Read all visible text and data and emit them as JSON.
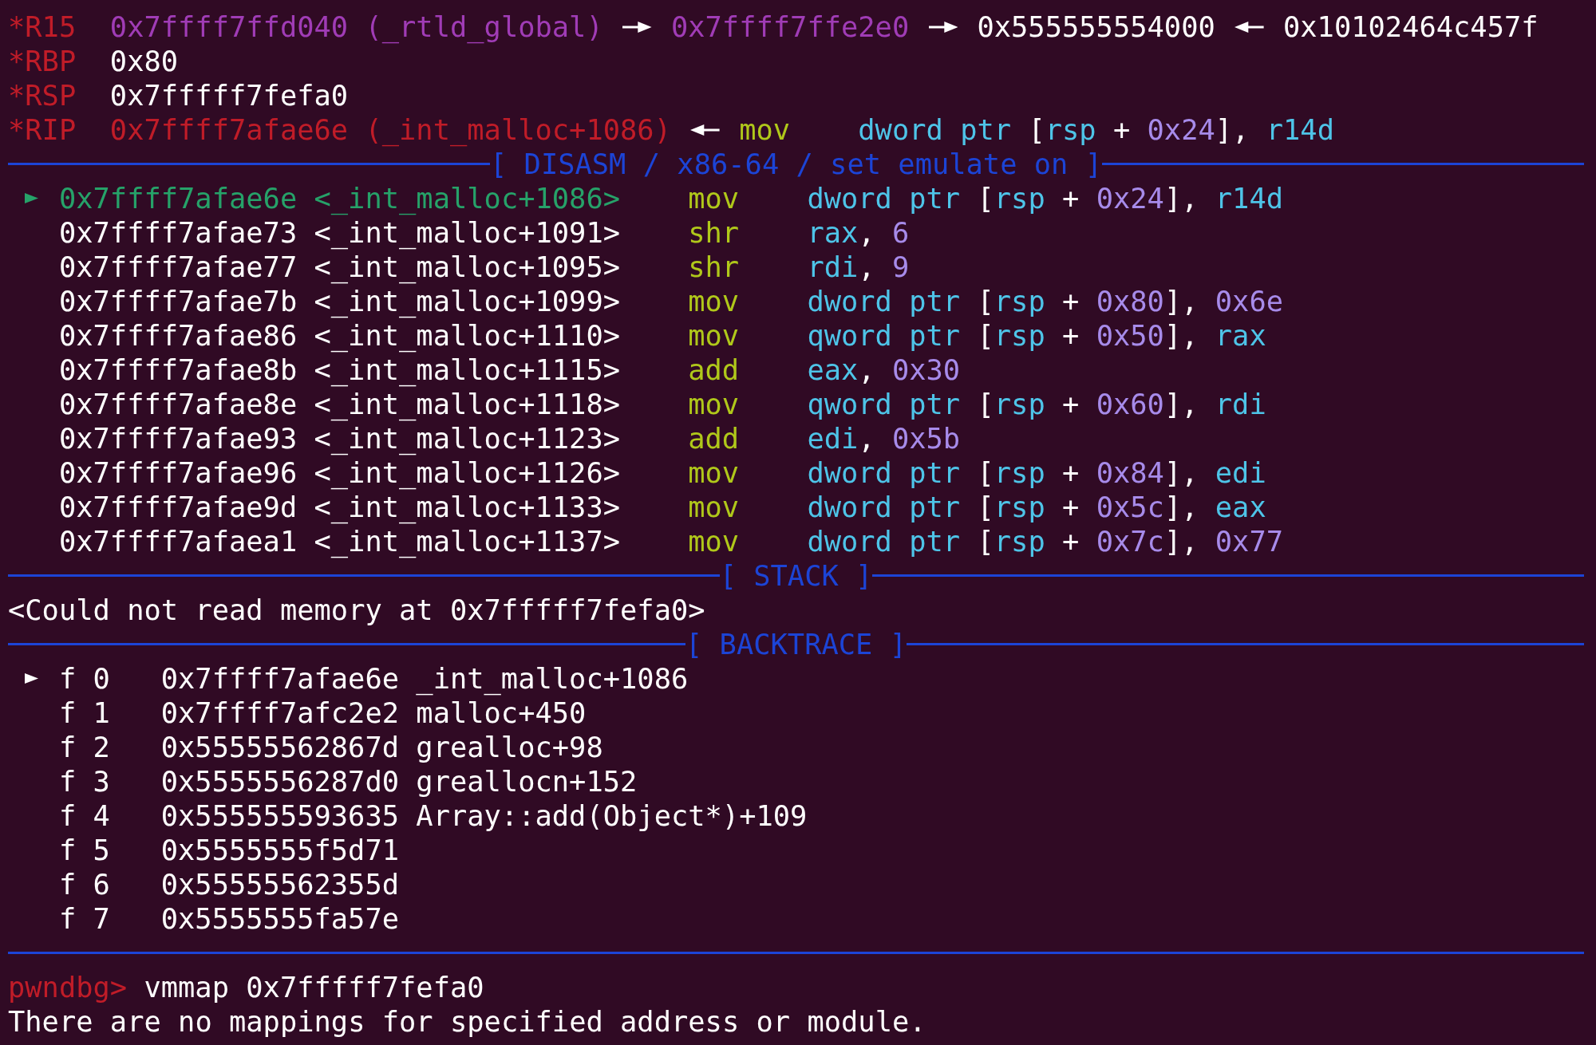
{
  "registers": [
    {
      "name": "*R15",
      "chain": [
        {
          "kind": "value",
          "text": "0x7ffff7ffd040 (_rtld_global)",
          "color": "#a03cb6"
        },
        {
          "kind": "arrow-right"
        },
        {
          "kind": "value",
          "text": "0x7ffff7ffe2e0",
          "color": "#a03cb6"
        },
        {
          "kind": "arrow-right"
        },
        {
          "kind": "value",
          "text": "0x555555554000",
          "color": "#ffffff"
        },
        {
          "kind": "arrow-left"
        },
        {
          "kind": "value",
          "text": "0x10102464c457f",
          "color": "#ffffff"
        }
      ]
    },
    {
      "name": "*RBP",
      "chain": [
        {
          "kind": "value",
          "text": "0x80",
          "color": "#ffffff"
        }
      ]
    },
    {
      "name": "*RSP",
      "chain": [
        {
          "kind": "value",
          "text": "0x7fffff7fefa0",
          "color": "#ffffff"
        }
      ]
    },
    {
      "name": "*RIP",
      "chain": [
        {
          "kind": "value",
          "text": "0x7ffff7afae6e (_int_malloc+1086)",
          "color": "#c01c28"
        },
        {
          "kind": "arrow-left"
        },
        {
          "kind": "instruction",
          "mnemonic": "mov",
          "operands": "dword ptr [rsp + 0x24], r14d"
        }
      ]
    }
  ],
  "disasm": {
    "title": "[ DISASM / x86-64 / set emulate on ]",
    "rows": [
      {
        "address": "0x7ffff7afae6e",
        "symbol": "<_int_malloc+1086>",
        "mnemonic": "mov",
        "operands": "dword ptr [rsp + 0x24], r14d",
        "current": true
      },
      {
        "address": "0x7ffff7afae73",
        "symbol": "<_int_malloc+1091>",
        "mnemonic": "shr",
        "operands": "rax, 6",
        "current": false
      },
      {
        "address": "0x7ffff7afae77",
        "symbol": "<_int_malloc+1095>",
        "mnemonic": "shr",
        "operands": "rdi, 9",
        "current": false
      },
      {
        "address": "0x7ffff7afae7b",
        "symbol": "<_int_malloc+1099>",
        "mnemonic": "mov",
        "operands": "dword ptr [rsp + 0x80], 0x6e",
        "current": false
      },
      {
        "address": "0x7ffff7afae86",
        "symbol": "<_int_malloc+1110>",
        "mnemonic": "mov",
        "operands": "qword ptr [rsp + 0x50], rax",
        "current": false
      },
      {
        "address": "0x7ffff7afae8b",
        "symbol": "<_int_malloc+1115>",
        "mnemonic": "add",
        "operands": "eax, 0x30",
        "current": false
      },
      {
        "address": "0x7ffff7afae8e",
        "symbol": "<_int_malloc+1118>",
        "mnemonic": "mov",
        "operands": "qword ptr [rsp + 0x60], rdi",
        "current": false
      },
      {
        "address": "0x7ffff7afae93",
        "symbol": "<_int_malloc+1123>",
        "mnemonic": "add",
        "operands": "edi, 0x5b",
        "current": false
      },
      {
        "address": "0x7ffff7afae96",
        "symbol": "<_int_malloc+1126>",
        "mnemonic": "mov",
        "operands": "dword ptr [rsp + 0x84], edi",
        "current": false
      },
      {
        "address": "0x7ffff7afae9d",
        "symbol": "<_int_malloc+1133>",
        "mnemonic": "mov",
        "operands": "dword ptr [rsp + 0x5c], eax",
        "current": false
      },
      {
        "address": "0x7ffff7afaea1",
        "symbol": "<_int_malloc+1137>",
        "mnemonic": "mov",
        "operands": "dword ptr [rsp + 0x7c], 0x77",
        "current": false
      }
    ]
  },
  "stack": {
    "title": "[ STACK ]",
    "message": "<Could not read memory at 0x7fffff7fefa0>"
  },
  "backtrace": {
    "title": "[ BACKTRACE ]",
    "frames": [
      {
        "frame": "f 0",
        "address": "0x7ffff7afae6e",
        "symbol": "_int_malloc+1086",
        "selected": true
      },
      {
        "frame": "f 1",
        "address": "0x7ffff7afc2e2",
        "symbol": "malloc+450",
        "selected": false
      },
      {
        "frame": "f 2",
        "address": "0x55555562867d",
        "symbol": "grealloc+98",
        "selected": false
      },
      {
        "frame": "f 3",
        "address": "0x5555556287d0",
        "symbol": "greallocn+152",
        "selected": false
      },
      {
        "frame": "f 4",
        "address": "0x555555593635",
        "symbol": "Array::add(Object*)+109",
        "selected": false
      },
      {
        "frame": "f 5",
        "address": "0x5555555f5d71",
        "selected": false
      },
      {
        "frame": "f 6",
        "address": "0x55555562355d",
        "selected": false
      },
      {
        "frame": "f 7",
        "address": "0x5555555fa57e",
        "selected": false
      }
    ]
  },
  "console": {
    "prompt": "pwndbg>",
    "command": "vmmap 0x7fffff7fefa0",
    "output": "There are no mappings for specified address or module."
  }
}
